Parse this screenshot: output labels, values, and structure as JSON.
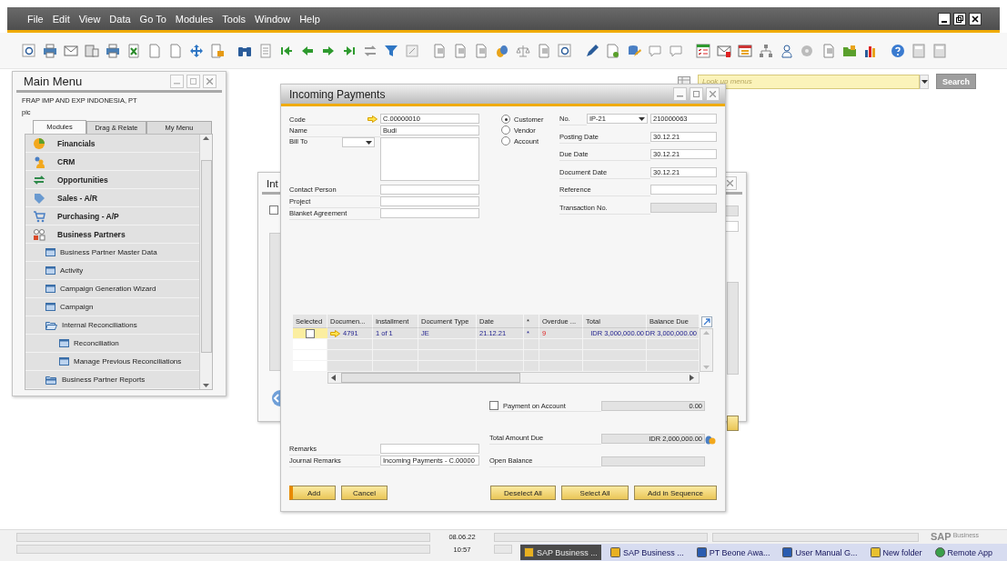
{
  "menu_bar": {
    "items": [
      "File",
      "Edit",
      "View",
      "Data",
      "Go To",
      "Modules",
      "Tools",
      "Window",
      "Help"
    ]
  },
  "lookup": {
    "placeholder": "Look up menus",
    "button": "Search"
  },
  "main_menu": {
    "title": "Main Menu",
    "company": "FRAP IMP AND EXP INDONESIA, PT",
    "user": "pic",
    "tabs": [
      {
        "label": "Modules",
        "selected": true
      },
      {
        "label": "Drag & Relate",
        "selected": false
      },
      {
        "label": "My Menu",
        "selected": false
      }
    ],
    "items": [
      {
        "label": "Financials",
        "kind": "module"
      },
      {
        "label": "CRM",
        "kind": "module"
      },
      {
        "label": "Opportunities",
        "kind": "module"
      },
      {
        "label": "Sales - A/R",
        "kind": "module"
      },
      {
        "label": "Purchasing - A/P",
        "kind": "module"
      },
      {
        "label": "Business Partners",
        "kind": "module",
        "children": [
          {
            "label": "Business Partner Master Data",
            "kind": "form"
          },
          {
            "label": "Activity",
            "kind": "form"
          },
          {
            "label": "Campaign Generation Wizard",
            "kind": "form"
          },
          {
            "label": "Campaign",
            "kind": "form"
          },
          {
            "label": "Internal Reconciliations",
            "kind": "folder",
            "expanded": true,
            "children": [
              {
                "label": "Reconciliation",
                "kind": "form"
              },
              {
                "label": "Manage Previous Reconciliations",
                "kind": "form"
              }
            ]
          },
          {
            "label": "Business Partner Reports",
            "kind": "folder",
            "expanded": false
          }
        ]
      }
    ]
  },
  "background_window": {
    "title": "Int",
    "checked": false
  },
  "dialog": {
    "title": "Incoming Payments",
    "left_fields": [
      {
        "label": "Code",
        "value": "C.00000010",
        "kind": "link"
      },
      {
        "label": "Name",
        "value": "Budi",
        "kind": "text"
      },
      {
        "label": "Bill To",
        "kind": "address"
      },
      {
        "label": "Contact Person",
        "kind": "text"
      },
      {
        "label": "Project",
        "kind": "text"
      },
      {
        "label": "Blanket Agreement",
        "kind": "text"
      }
    ],
    "partner_type": [
      {
        "label": "Customer",
        "selected": true
      },
      {
        "label": "Vendor",
        "selected": false
      },
      {
        "label": "Account",
        "selected": false
      }
    ],
    "right_fields": [
      {
        "label": "No.",
        "series": "IP-21",
        "value": "210000063",
        "kind": "series",
        "disabled": false
      },
      {
        "label": "Posting Date",
        "value": "30.12.21",
        "kind": "text",
        "disabled": false
      },
      {
        "label": "Due Date",
        "value": "30.12.21",
        "kind": "text",
        "disabled": false
      },
      {
        "label": "Document Date",
        "value": "30.12.21",
        "kind": "text",
        "disabled": false
      },
      {
        "label": "Reference",
        "kind": "text",
        "disabled": false
      },
      {
        "label": "Transaction No.",
        "kind": "text",
        "disabled": true
      }
    ],
    "table": {
      "columns": [
        "Selected",
        "Documen...",
        "Installment",
        "Document Type",
        "Date",
        "*",
        "Overdue ...",
        "Total",
        "Balance Due"
      ],
      "rows": [
        {
          "selected": false,
          "cells": [
            "",
            "4791",
            "1 of 1",
            "JE",
            "21.12.21",
            "*",
            "9",
            "IDR 3,000,000.00",
            "DR 3,000,000.00"
          ]
        }
      ]
    },
    "payment_on_account": {
      "label": "Payment on Account",
      "checked": false,
      "value": "0.00"
    },
    "totals": [
      {
        "label": "Total Amount Due",
        "value": "IDR 2,000,000.00"
      },
      {
        "label": "Open Balance"
      }
    ],
    "remarks": [
      {
        "label": "Remarks"
      },
      {
        "label": "Journal Remarks",
        "value": "Incoming Payments - C.00000"
      }
    ],
    "buttons_left": [
      "Add",
      "Cancel"
    ],
    "buttons_right": [
      "Deselect All",
      "Select All",
      "Add in Sequence"
    ]
  },
  "status_bar": {
    "date": "08.06.22",
    "time": "10:57",
    "logo": "SAP",
    "logo_caption": "Business"
  },
  "taskbar": {
    "items": [
      {
        "label": "SAP Business ...",
        "selected": true
      },
      {
        "label": "SAP Business ...",
        "selected": false
      },
      {
        "label": "PT Beone Awa...",
        "selected": false
      },
      {
        "label": "User Manual G...",
        "selected": false
      },
      {
        "label": "New folder",
        "selected": false
      },
      {
        "label": "Remote App",
        "selected": false
      }
    ]
  }
}
